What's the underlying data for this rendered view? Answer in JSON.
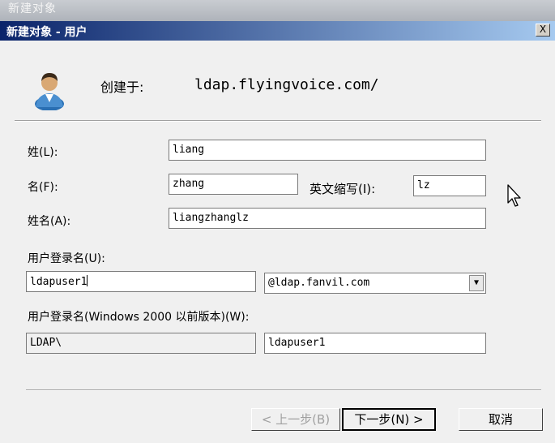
{
  "background_title": "新建对象",
  "dialog": {
    "title": "新建对象 - 用户",
    "close_glyph": "X"
  },
  "header": {
    "created_in_label": "创建于:",
    "created_in_value": "ldap.flyingvoice.com/",
    "icon": "user-icon"
  },
  "form": {
    "last_name_label": "姓(L):",
    "last_name_value": "liang",
    "first_name_label": "名(F):",
    "first_name_value": "zhang",
    "initials_label": "英文缩写(I):",
    "initials_value": "lz",
    "full_name_label": "姓名(A):",
    "full_name_value": "liangzhanglz",
    "logon_name_label": "用户登录名(U):",
    "logon_name_value": "ldapuser1",
    "domain_value": "@ldap.fanvil.com",
    "pre2000_label": "用户登录名(Windows 2000 以前版本)(W):",
    "pre2000_domain_value": "LDAP\\",
    "pre2000_user_value": "ldapuser1"
  },
  "buttons": {
    "back": "< 上一步(B)",
    "next": "下一步(N) >",
    "cancel": "取消"
  },
  "colors": {
    "titlebar_start": "#0a246a",
    "titlebar_end": "#a6caf0",
    "dialog_bg": "#f0f0f0"
  }
}
